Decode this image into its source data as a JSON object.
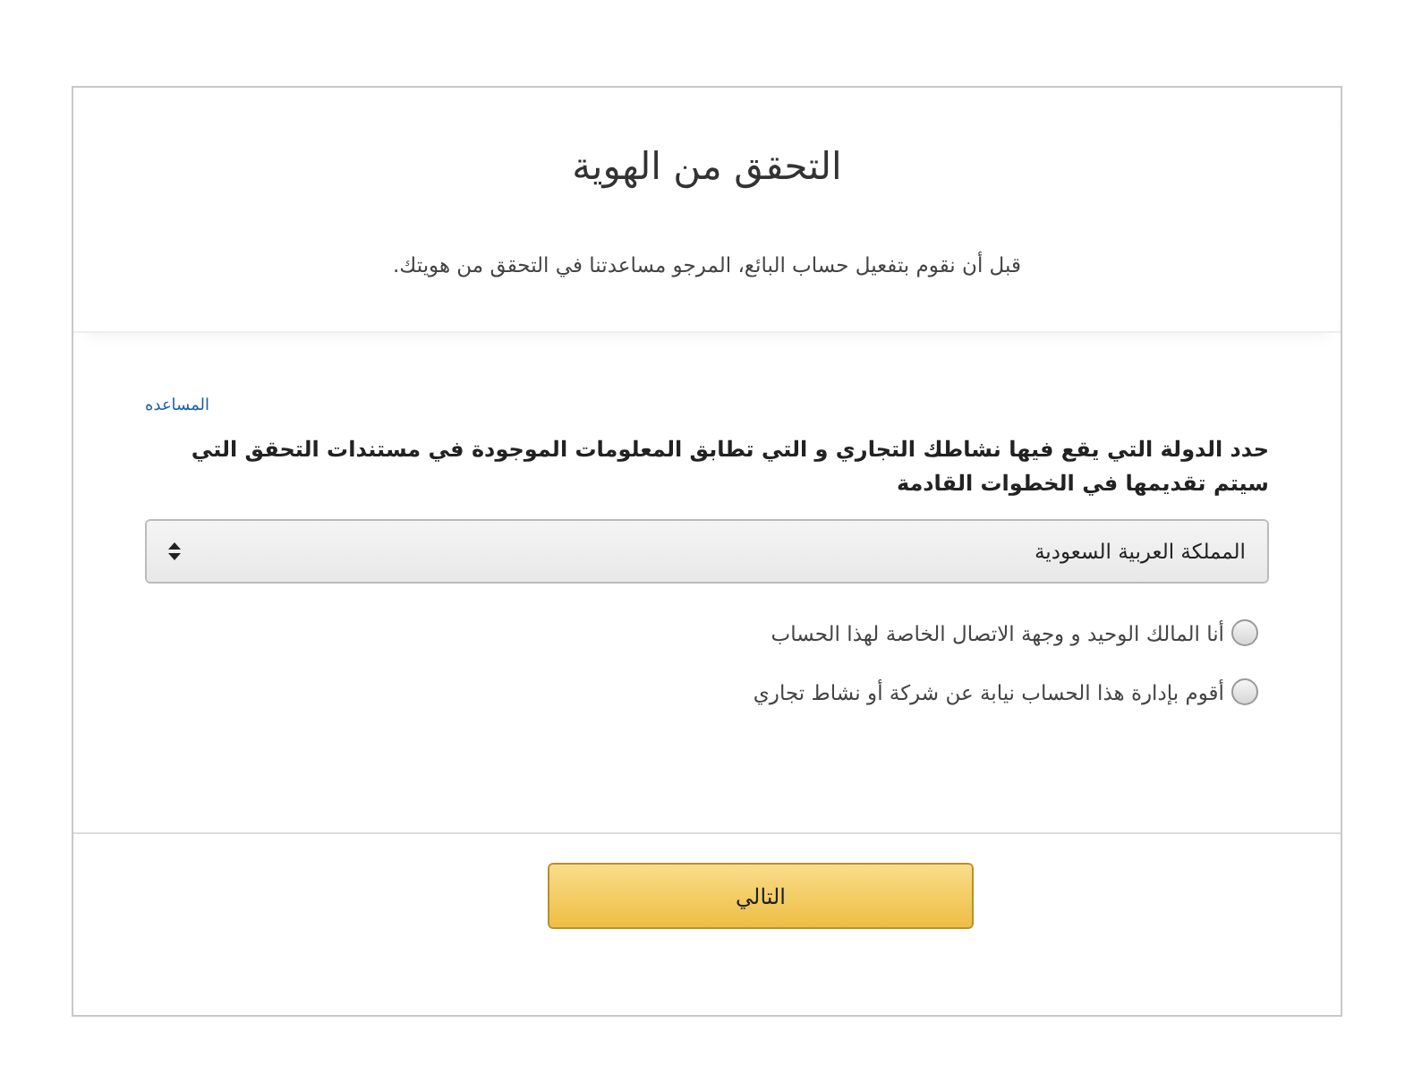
{
  "title": "التحقق من الهوية",
  "subtitle": "قبل أن نقوم بتفعيل حساب البائع، المرجو مساعدتنا في التحقق من هويتك.",
  "help_link": "المساعده",
  "country_label": "حدد الدولة التي يقع فيها نشاطك التجاري و التي تطابق المعلومات الموجودة في مستندات التحقق التي سيتم تقديمها في الخطوات القادمة",
  "country_select": {
    "value": "المملكة العربية السعودية"
  },
  "options": [
    {
      "label": "أنا المالك الوحيد و وجهة الاتصال الخاصة لهذا الحساب",
      "selected": false
    },
    {
      "label": "أقوم بإدارة هذا الحساب نيابة عن شركة أو نشاط تجاري",
      "selected": false
    }
  ],
  "next_button": "التالي"
}
